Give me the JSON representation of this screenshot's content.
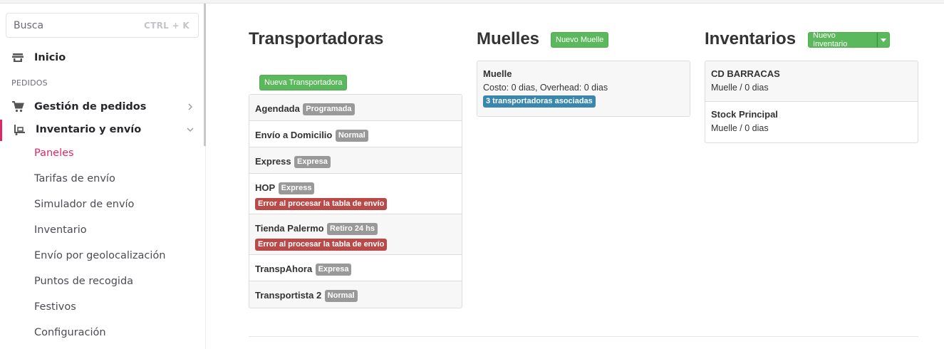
{
  "sidebar": {
    "search": {
      "label": "Busca",
      "shortcut": "CTRL + K"
    },
    "home": {
      "label": "Inicio",
      "icon": "store-icon"
    },
    "section": "PEDIDOS",
    "orders": {
      "label": "Gestión de pedidos",
      "icon": "cart-icon"
    },
    "inventory": {
      "label": "Inventario y envío",
      "icon": "forklift-icon"
    },
    "subitems": [
      "Paneles",
      "Tarifas de envío",
      "Simulador de envío",
      "Inventario",
      "Envío por geolocalización",
      "Puntos de recogida",
      "Festivos",
      "Configuración"
    ],
    "active_color": "#e02667"
  },
  "carriers": {
    "title": "Transportadoras",
    "new_button": "Nueva Transportadora",
    "items": [
      {
        "name": "Agendada",
        "tag": "Programada",
        "error": ""
      },
      {
        "name": "Envío a Domicilio",
        "tag": "Normal",
        "error": ""
      },
      {
        "name": "Express",
        "tag": "Expresa",
        "error": ""
      },
      {
        "name": "HOP",
        "tag": "Express",
        "error": "Error al procesar la tabla de envío"
      },
      {
        "name": "Tienda Palermo",
        "tag": "Retiro 24 hs",
        "error": "Error al procesar la tabla de envío"
      },
      {
        "name": "TranspAhora",
        "tag": "Expresa",
        "error": ""
      },
      {
        "name": "Transportista 2",
        "tag": "Normal",
        "error": ""
      }
    ]
  },
  "docks": {
    "title": "Muelles",
    "new_button": "Nuevo Muelle",
    "items": [
      {
        "name": "Muelle",
        "detail": "Costo: 0 dias, Overhead: 0 dias",
        "badge": "3 transportadoras asociadas"
      }
    ]
  },
  "inventories": {
    "title": "Inventarios",
    "new_button": "Nuevo Inventario",
    "items": [
      {
        "name": "CD BARRACAS",
        "detail": "Muelle / 0 dias"
      },
      {
        "name": "Stock Principal",
        "detail": "Muelle / 0 dias"
      }
    ]
  },
  "colors": {
    "success": "#5cb85c",
    "danger": "#b94a48",
    "info": "#3a87ad",
    "default": "#999999"
  }
}
